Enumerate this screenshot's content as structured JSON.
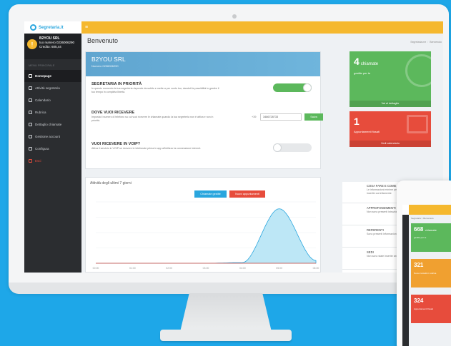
{
  "brand": {
    "logo_text": "Segretaria.it"
  },
  "user": {
    "avatar": "!",
    "company": "B2YOU SRL",
    "number_line": "tuo numero 0236006290",
    "credit": "Credito: 605,44"
  },
  "sidebar": {
    "heading": "MENU PRINCIPALE",
    "items": [
      {
        "label": "Homepage",
        "active": true
      },
      {
        "label": "Attività segretaria"
      },
      {
        "label": "Calendario"
      },
      {
        "label": "Rubrica"
      },
      {
        "label": "Dettaglio chiamate"
      },
      {
        "label": "Gestione account"
      },
      {
        "label": "Configura"
      },
      {
        "label": "Esci",
        "exit": true
      }
    ]
  },
  "topbar": {
    "menu_icon": "≡"
  },
  "header": {
    "title": "Benvenuto",
    "breadcrumb": [
      "Segretaria.me",
      "Benvenuto"
    ]
  },
  "company_card": {
    "name": "B2YOU SRL",
    "number": "Numero 0236006290",
    "priority": {
      "title": "SEGRETARIA IN PRIORITÀ",
      "desc": "In questo momento la tua segreteria risponde da subito e mette a per conto tuo; dandoti la possibilità in gestire il tuo tempo in completa libertà."
    },
    "forward": {
      "title": "DOVE VUOI RICEVERE",
      "desc": "Imposta il numero di telefono su cui vuoi ricevere le chiamate quando la tua segreteria non è attiva e non in priorità.",
      "prefix": "+39",
      "phone": "3486728733",
      "save_label": "Salva"
    },
    "voip": {
      "title": "VUOI RICEVERE IN VOIP?",
      "desc": "Attiva il servizio in VOIP se ricevere le telefonate prima in app all'utilizzo la connessione internet."
    }
  },
  "tiles": {
    "calls": {
      "number": "4",
      "unit": "chiamate",
      "label": "gestite per te",
      "footer": "Vai al dettaglio"
    },
    "appointments": {
      "number": "1",
      "label": "Appuntamenti fissati",
      "footer": "Vedi calendario"
    }
  },
  "chart_data": {
    "type": "area",
    "title": "Attività degli ultimi 7 giorni",
    "legend": [
      "Chiamate gestite",
      "Nuovi appuntamenti"
    ],
    "legend_colors": [
      "#2aa6de",
      "#e74c3c"
    ],
    "x": [
      "00:00",
      "01:00",
      "02:00",
      "03:00",
      "04:00",
      "05:00",
      "06:00"
    ],
    "series": [
      {
        "name": "Chiamate gestite",
        "values": [
          0,
          0,
          0,
          0,
          0.05,
          4,
          0.2
        ]
      },
      {
        "name": "Nuovi appuntamenti",
        "values": [
          0,
          0,
          0,
          0,
          0,
          0,
          0
        ]
      }
    ],
    "ylim": [
      0,
      4.5
    ]
  },
  "info": [
    {
      "title": "COSA FARE E COME RISPONDERE",
      "desc": "Le informazioni minime per la tua segretaria sono state inserite correttamente",
      "color": "#5cb85c",
      "icon": "chat"
    },
    {
      "title": "APPROFONDIMENTI",
      "desc": "Non sono presenti istruzioni per la tua segretaria",
      "color": "#2aa6de",
      "icon": "gear"
    },
    {
      "title": "REFERENTI",
      "desc": "Sono presenti informazioni per 1 per inoltro chiamate",
      "color": "#f0a030",
      "icon": "people"
    },
    {
      "title": "SEDI",
      "desc": "Non sono state inserite sedi",
      "color": "#f5b82e",
      "icon": "pin"
    }
  ],
  "tablet": {
    "breadcrumb": "Segretaria > Benvenuto",
    "tiles": [
      {
        "number": "668",
        "unit": "chiamate",
        "label": "gestite per te",
        "color": "#5cb85c"
      },
      {
        "number": "321",
        "label": "Nuovi contatti in rubrica",
        "color": "#f0a030"
      },
      {
        "number": "324",
        "label": "Appuntamenti fissati",
        "color": "#e74c3c"
      }
    ]
  }
}
